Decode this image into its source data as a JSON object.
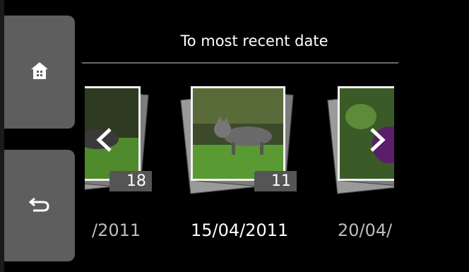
{
  "header": {
    "title": "To most recent date"
  },
  "sidebar": {
    "home_icon": "home-icon",
    "back_icon": "back-arrow-icon"
  },
  "carousel": {
    "items": [
      {
        "date": "/2011",
        "count": "18"
      },
      {
        "date": "15/04/2011",
        "count": "11"
      },
      {
        "date": "20/04/",
        "count": ""
      }
    ]
  },
  "colors": {
    "background": "#000000",
    "side_button": "#5e5e5e",
    "rule": "#6a6a6a"
  }
}
